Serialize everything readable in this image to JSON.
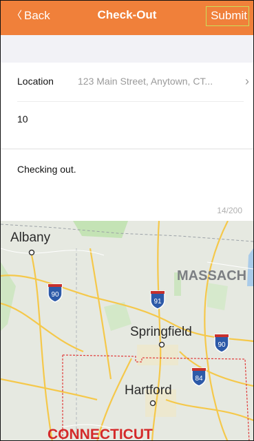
{
  "header": {
    "back_label": "Back",
    "title": "Check-Out",
    "submit_label": "Submit"
  },
  "form": {
    "location_label": "Location",
    "location_value": "123 Main Street, Anytown, CT...",
    "number_value": "10",
    "note_text": "Checking out.",
    "char_counter": "14/200"
  },
  "map": {
    "labels": {
      "albany": "Albany",
      "massachusetts": "MASSACH",
      "springfield": "Springfield",
      "hartford": "Hartford",
      "connecticut": "CONNECTICUT"
    },
    "highways": [
      "90",
      "91",
      "90",
      "84"
    ]
  },
  "colors": {
    "header": "#f0803a",
    "submit_outline": "#c9e05b",
    "state_border": "#e03a3a",
    "state_label": "#d42a2a",
    "interstate_shield": "#2d5aa8"
  }
}
